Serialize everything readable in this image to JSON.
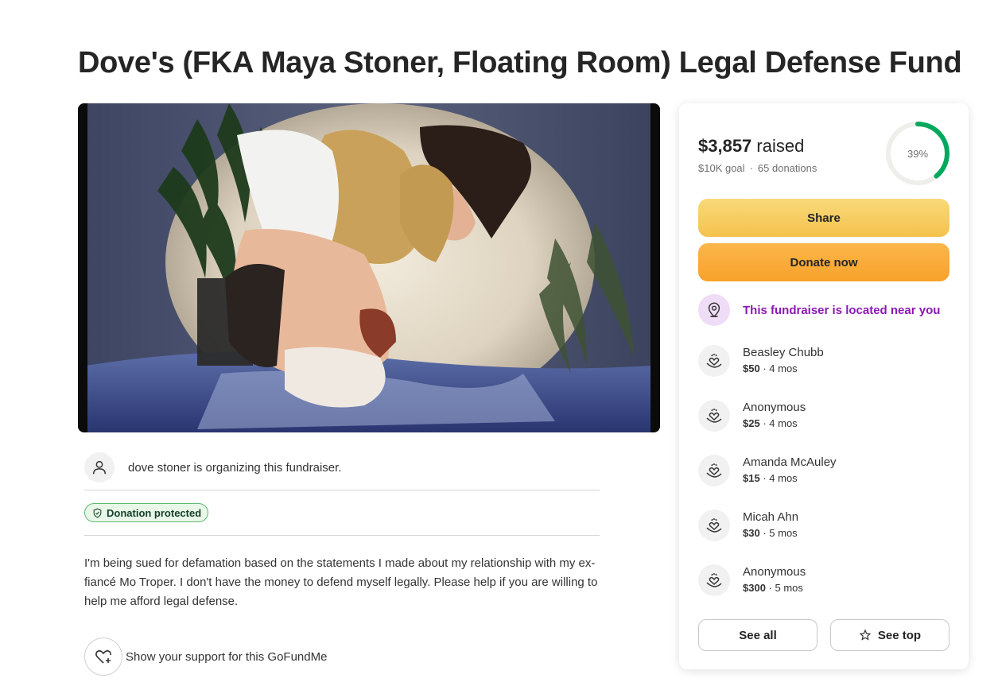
{
  "page": {
    "title": "Dove's (FKA Maya Stoner, Floating Room) Legal Defense Fund"
  },
  "organizer": {
    "text": "dove stoner is organizing this fundraiser."
  },
  "badge": {
    "label": "Donation protected"
  },
  "story": {
    "text": "I'm being sued for defamation based on the statements I made about my relationship with my ex-fiancé Mo Troper. I don't have the money to defend myself legally. Please help if you are willing to help me afford legal defense."
  },
  "support": {
    "label": "Show your support for this GoFundMe"
  },
  "summary": {
    "raised_amount": "$3,857",
    "raised_word": "raised",
    "goal": "$10K goal",
    "separator": "·",
    "donations": "65 donations",
    "progress_label": "39%",
    "progress_fraction": 0.39
  },
  "buttons": {
    "share": "Share",
    "donate": "Donate now",
    "see_all": "See all",
    "see_top": "See top"
  },
  "nearby": {
    "text": "This fundraiser is located near you"
  },
  "donations": [
    {
      "name": "Beasley Chubb",
      "amount": "$50",
      "time": "· 4 mos"
    },
    {
      "name": "Anonymous",
      "amount": "$25",
      "time": "· 4 mos"
    },
    {
      "name": "Amanda McAuley",
      "amount": "$15",
      "time": "· 4 mos"
    },
    {
      "name": "Micah Ahn",
      "amount": "$30",
      "time": "· 5 mos"
    },
    {
      "name": "Anonymous",
      "amount": "$300",
      "time": "· 5 mos"
    }
  ],
  "colors": {
    "accent_green": "#02a95c",
    "nearby_purple": "#8a19b3",
    "share_yellow": "#f6cd5f",
    "donate_orange": "#f9ab37"
  },
  "icons": {
    "organizer": "user-icon",
    "badge": "shield-check-icon",
    "support": "heart-plus-icon",
    "nearby": "location-pin-icon",
    "donation": "hand-heart-icon",
    "see_top": "star-icon"
  }
}
